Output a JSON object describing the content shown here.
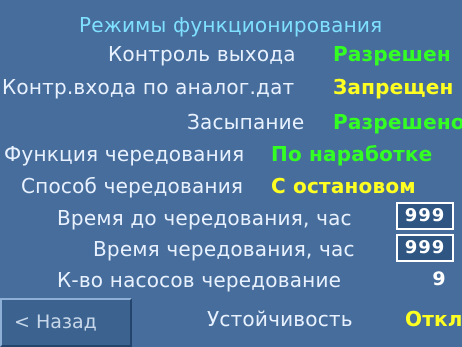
{
  "title": "Режимы функционирования",
  "rows": [
    {
      "label": "Контроль выхода",
      "value": "Разрешен"
    },
    {
      "label": "Контр.входа по аналог.дат",
      "value": "Запрещен"
    },
    {
      "label": "Засыпание",
      "value": "Разрешено"
    },
    {
      "label": "Функция чередования",
      "value": "По наработке"
    },
    {
      "label": "Способ чередования",
      "value": "С остановом"
    }
  ],
  "numeric_rows": [
    {
      "label": "Время до чередования, час",
      "value": "999"
    },
    {
      "label": "Время чередования, час",
      "value": "999"
    },
    {
      "label": "К-во насосов чередование",
      "value": "9"
    }
  ],
  "stability": {
    "label": "Устойчивость",
    "value": "Откл"
  },
  "back_button": {
    "label": "< Назад"
  },
  "colors": {
    "background": "#466d9b",
    "enabled_value": "#33ff22",
    "disabled_value": "#ffff22",
    "label": "#e8f1ff"
  }
}
